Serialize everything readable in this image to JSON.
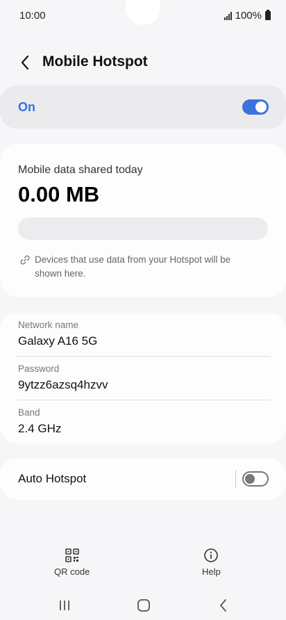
{
  "status_bar": {
    "time": "10:00",
    "battery": "100%"
  },
  "header": {
    "title": "Mobile Hotspot"
  },
  "hotspot_switch": {
    "label": "On",
    "enabled": true,
    "accent_color": "#3b72e0"
  },
  "usage": {
    "label": "Mobile data shared today",
    "value": "0.00 MB",
    "note": "Devices that use data from your Hotspot will be shown here."
  },
  "network": {
    "name_label": "Network name",
    "name_value": "Galaxy A16 5G",
    "password_label": "Password",
    "password_value": "9ytzz6azsq4hzvv",
    "band_label": "Band",
    "band_value": "2.4 GHz"
  },
  "auto_hotspot": {
    "label": "Auto Hotspot",
    "enabled": false
  },
  "bottom_actions": {
    "qr_label": "QR code",
    "help_label": "Help"
  },
  "nav_bar": {
    "icons": [
      "recent-apps-icon",
      "home-icon",
      "back-icon"
    ]
  }
}
